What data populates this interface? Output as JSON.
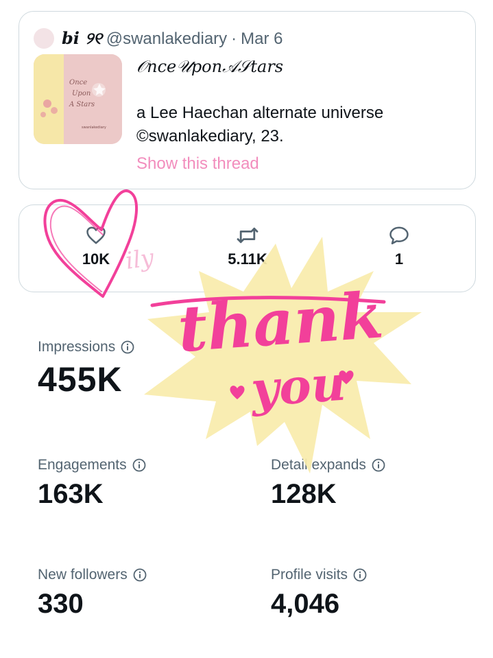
{
  "tweet": {
    "display_name": "bi ୨୧",
    "handle": "@swanlakediary",
    "separator": "·",
    "date": "Mar 6",
    "title": "𝒪nce𝒰pon𝒜𝒮tars",
    "line2": "a Lee Haechan alternate universe",
    "line3": "©swanlakediary, 23.",
    "show_thread": "Show this thread",
    "thumbnail": {
      "cover_title": [
        "Once",
        "Upon",
        "A Stars"
      ],
      "cover_author": "swanlakediary"
    }
  },
  "engagement": {
    "likes": "10K",
    "reposts": "5.11K",
    "replies": "1",
    "icons": [
      "heart-icon",
      "repost-icon",
      "reply-icon"
    ]
  },
  "metrics": {
    "impressions": {
      "label": "Impressions",
      "value": "455K"
    },
    "engagements": {
      "label": "Engagements",
      "value": "163K"
    },
    "detail_expands": {
      "label": "Detail expands",
      "value": "128K"
    },
    "new_followers": {
      "label": "New followers",
      "value": "330"
    },
    "profile_visits": {
      "label": "Profile visits",
      "value": "4,046"
    }
  },
  "sticker": {
    "text_line1": "thank",
    "text_line2": "you",
    "doodle": "ily",
    "colors": {
      "pink": "#f2409a",
      "star": "#f9ecab",
      "light_pink": "#f6b6d4"
    }
  },
  "colors": {
    "text": "#0f1419",
    "secondary": "#536471",
    "border": "#cfd9de",
    "link": "#f28dbd"
  }
}
